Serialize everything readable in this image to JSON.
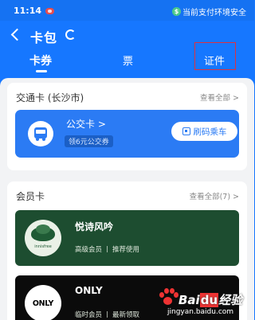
{
  "status_bar": {
    "time": "11:14",
    "secure_text": "当前支付环境安全",
    "secure_icon_glyph": "$"
  },
  "header": {
    "title": "卡包"
  },
  "tabs": [
    {
      "label": "卡券",
      "active": true
    },
    {
      "label": "票",
      "active": false
    },
    {
      "label": "证件",
      "active": false,
      "highlighted": true
    }
  ],
  "transit": {
    "section_title": "交通卡 (长沙市)",
    "view_all": "查看全部 >",
    "card": {
      "name": "公交卡 >",
      "badge": "领6元公交券",
      "button_label": "刷码乘车"
    }
  },
  "member": {
    "section_title": "会员卡",
    "view_all": "查看全部(7) >",
    "cards": [
      {
        "name": "悦诗风吟",
        "level": "高级会员",
        "action": "推荐使用",
        "color": "#1d4d30",
        "logo_text": "innisfree"
      },
      {
        "name": "ONLY",
        "level": "临时会员",
        "action": "最新领取",
        "color": "#0b0b0b",
        "logo_text": "ONLY"
      }
    ]
  },
  "watermark": {
    "brand_a": "Bai",
    "brand_du": "du",
    "brand_b": "经验",
    "url": "jingyan.baidu.com"
  },
  "colors": {
    "primary": "#1677ff",
    "transit_card": "#2b7bf4",
    "annotation": "#e0303e"
  }
}
